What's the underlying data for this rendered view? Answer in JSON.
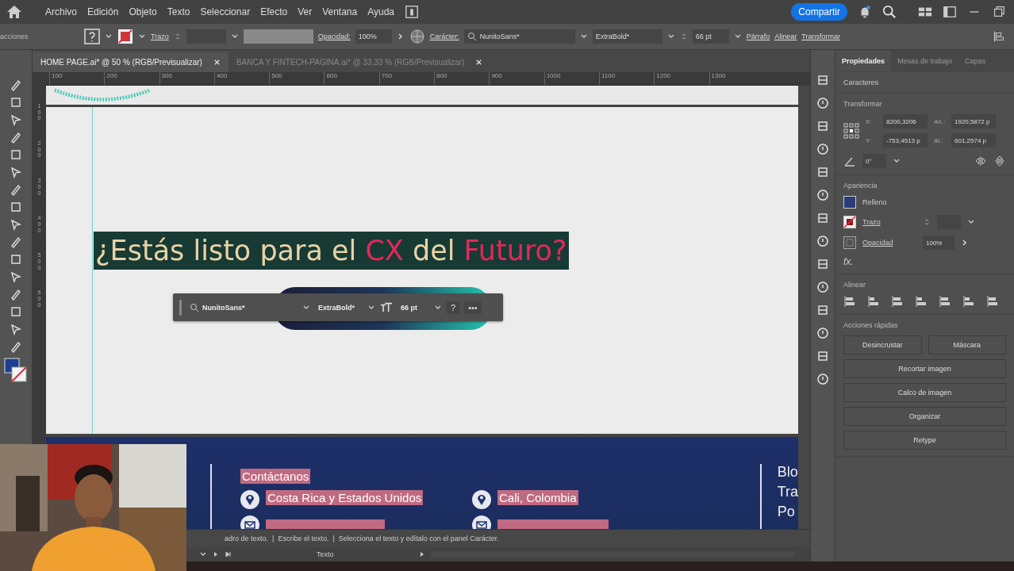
{
  "menu": [
    "Archivo",
    "Edición",
    "Objeto",
    "Texto",
    "Seleccionar",
    "Efecto",
    "Ver",
    "Ventana",
    "Ayuda"
  ],
  "share_button": "Compartir",
  "control_bar": {
    "left_label": "acciones",
    "stroke_label": "Trazo",
    "opacity_label": "Opacidad:",
    "opacity_value": "100%",
    "character_label": "Carácter:",
    "font": "NunitoSans*",
    "style": "ExtraBold*",
    "size": "66 pt",
    "links": [
      "Párrafo",
      "Alinear",
      "Transformar"
    ]
  },
  "tabs": [
    {
      "label": "HOME PAGE.ai* @ 50 % (RGB/Previsualizar)",
      "selected": true
    },
    {
      "label": "BANCA Y FINTECH-PAGINA.ai* @ 33,33 % (RGB/Previsualizar)",
      "selected": false
    }
  ],
  "ruler": [
    "100",
    "200",
    "300",
    "400",
    "500",
    "600",
    "700",
    "800",
    "900",
    "1000",
    "1100",
    "1200",
    "1300"
  ],
  "vertical_ruler": [
    "100",
    "200",
    "300",
    "400",
    "500",
    "600"
  ],
  "headline": [
    {
      "text": "¿Estás listo para el ",
      "accent": false
    },
    {
      "text": "CX",
      "accent": true
    },
    {
      "text": " del ",
      "accent": false
    },
    {
      "text": "Futuro?",
      "accent": true
    }
  ],
  "floating_toolbar": {
    "font": "NunitoSans*",
    "style": "ExtraBold*",
    "size": "66 pt",
    "help": "?",
    "more": "•••"
  },
  "footer": {
    "heading": "Contáctanos",
    "locations": [
      "Costa Rica y Estados Unidos",
      "Cali, Colombia"
    ],
    "right_column": [
      "Blo",
      "Tra",
      "Po"
    ]
  },
  "panel": {
    "tabs": [
      {
        "label": "Propiedades",
        "selected": true
      },
      {
        "label": "Mesas de trabajo",
        "selected": false
      },
      {
        "label": "Capas",
        "selected": false
      }
    ],
    "selection_label": "Caracteres",
    "transform_title": "Transformar",
    "transform_fields": [
      {
        "label": "X:",
        "value": "8200,3206"
      },
      {
        "label": "An.:",
        "value": "1920,5872 p"
      },
      {
        "label": "Y:",
        "value": "-753,4513 p"
      },
      {
        "label": "Al.:",
        "value": "601,2574 p"
      }
    ],
    "angle": "0°",
    "appearance_title": "Apariencia",
    "fill_label": "Relleno",
    "stroke_label": "Trazo",
    "opacity_label": "Opacidad",
    "opacity_value": "100%",
    "fx": "fx.",
    "align_title": "Alinear",
    "actions_title": "Acciones rápidas",
    "actions": [
      "Desincrustar",
      "Máscara",
      "Recortar imagen",
      "Calco de imagen",
      "Organizar",
      "Retype"
    ]
  },
  "status_text": "adro de texto.  |  Escribe el texto.  |  Selecciona el texto y edítalo con el panel Carácter.",
  "bottom_label": "Texto"
}
